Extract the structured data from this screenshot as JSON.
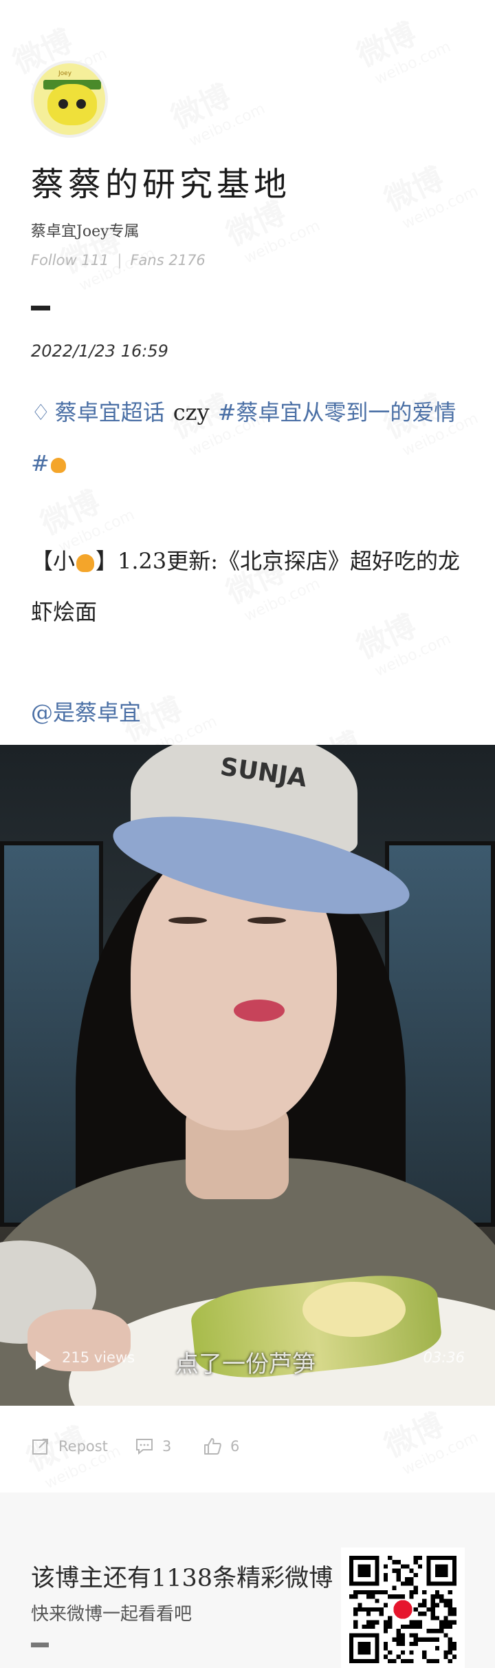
{
  "watermark": {
    "cn": "微博",
    "en": "weibo.com"
  },
  "profile": {
    "avatar_text": "Joey",
    "name": "蔡蔡的研究基地",
    "tagline": "蔡卓宜Joey专属",
    "follow": "Follow 111",
    "fans": "Fans 2176"
  },
  "post": {
    "datetime": "2022/1/23 16:59",
    "topic_supertopic": "蔡卓宜超话",
    "topic_user": "czy",
    "topic_tag": "#蔡卓宜从零到一的爱情#",
    "update_prefix": "【小",
    "update_text": "】1.23更新:《北京探店》超好吃的龙虾烩面",
    "mention": "@是蔡卓宜"
  },
  "video": {
    "cap_logo": "SUNJA",
    "views": "215 views",
    "caption": "点了一份芦笋",
    "duration": "03:36"
  },
  "actions": {
    "repost": "Repost",
    "comments": "3",
    "likes": "6"
  },
  "promo": {
    "headline": "该博主还有1138条精彩微博",
    "subline": "快来微博一起看看吧"
  },
  "colors": {
    "link": "#4a6fa5",
    "muted": "#b5b5b5",
    "promo_bg": "#f7f7f7"
  }
}
